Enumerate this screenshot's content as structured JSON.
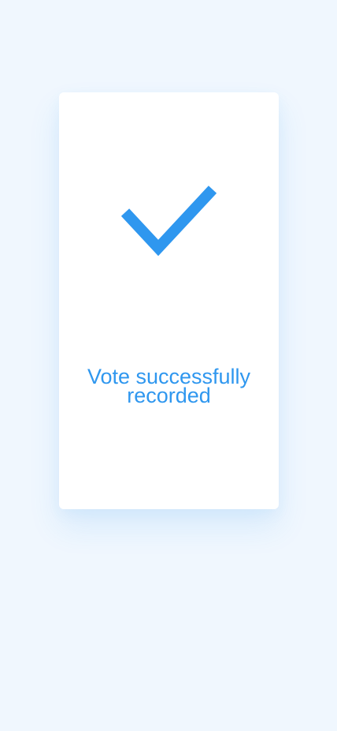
{
  "status": {
    "message": "Vote successfully recorded",
    "icon": "checkmark-icon"
  },
  "colors": {
    "background": "#f0f7fe",
    "card": "#ffffff",
    "accent": "#2f97ef"
  }
}
